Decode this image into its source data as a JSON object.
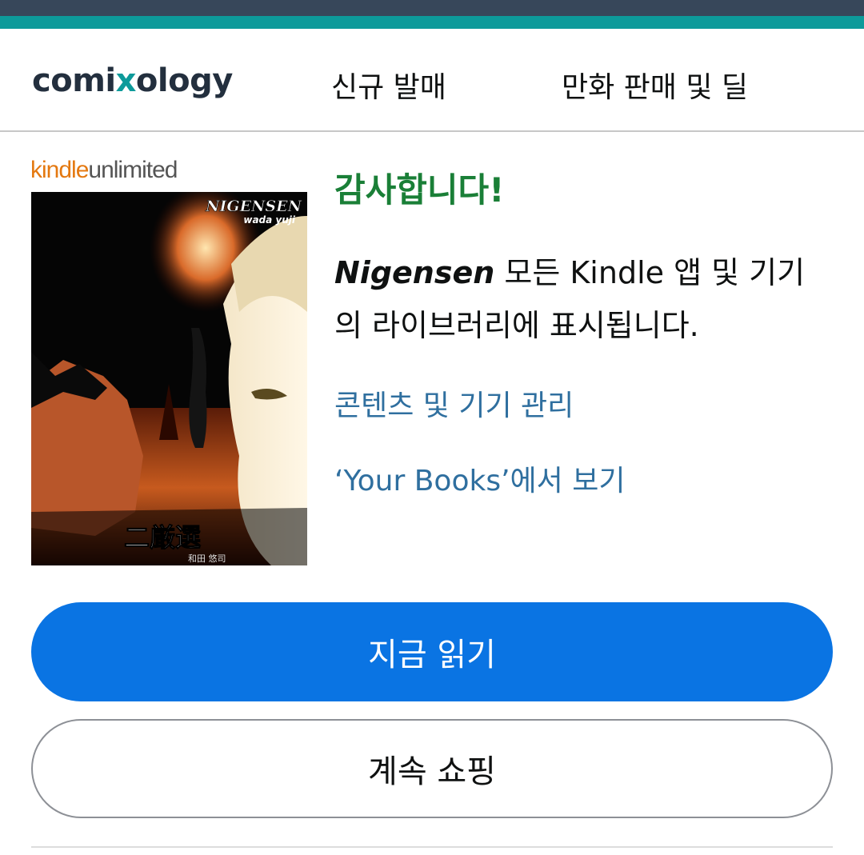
{
  "header": {
    "logo_pre": "comi",
    "logo_x": "x",
    "logo_post": "ology",
    "nav": {
      "new_releases": "신규 발매",
      "deals": "만화 판매 및 딜"
    }
  },
  "badge": {
    "kindle": "kindle",
    "unlimited": "unlimited"
  },
  "cover": {
    "title": "NIGENSEN",
    "author": "wada yuji",
    "jp_title": "二厳選",
    "jp_author": "和田 悠司"
  },
  "confirmation": {
    "heading": "감사합니다!",
    "book_title": "Nigensen",
    "message": " 모든 Kindle 앱 및 기기의 라이브러리에 표시됩니다.",
    "manage_link": "콘텐츠 및 기기 관리",
    "your_books_link": "‘Your Books’에서 보기"
  },
  "actions": {
    "read_now": "지금 읽기",
    "continue_shopping": "계속 쇼핑"
  },
  "colors": {
    "top_strip": "#37475a",
    "teal_strip": "#0d9a9a",
    "heading_green": "#1a7f37",
    "link_blue": "#2f6f9f",
    "primary_button": "#0a74e3"
  }
}
